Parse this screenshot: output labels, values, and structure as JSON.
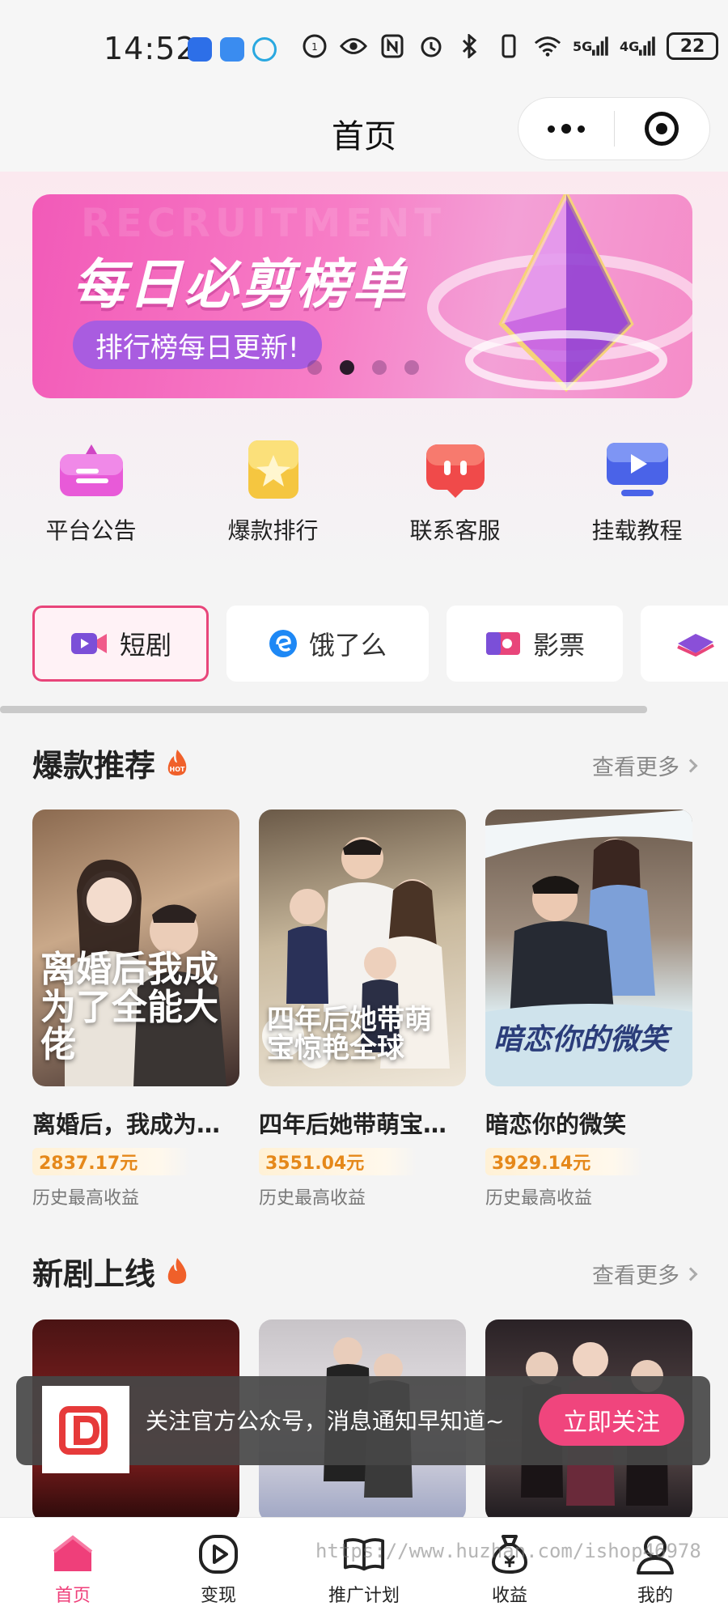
{
  "status_bar": {
    "time": "14:52",
    "net1": "5G",
    "net2": "4G",
    "battery": "22"
  },
  "nav": {
    "title": "首页"
  },
  "banner": {
    "title": "每日必剪榜单",
    "subtitle": "排行榜每日更新!",
    "ghost_text": "RECRUITMENT",
    "active_dot": 1
  },
  "quick_menu": [
    {
      "label": "平台公告",
      "icon": "announcement-icon"
    },
    {
      "label": "爆款排行",
      "icon": "ranking-star-icon"
    },
    {
      "label": "联系客服",
      "icon": "customer-service-icon"
    },
    {
      "label": "挂载教程",
      "icon": "tutorial-video-icon"
    }
  ],
  "categories": [
    {
      "label": "短剧",
      "active": true
    },
    {
      "label": "饿了么",
      "active": false
    },
    {
      "label": "影票",
      "active": false
    },
    {
      "label": "",
      "active": false
    }
  ],
  "hot_section": {
    "title": "爆款推荐",
    "more": "查看更多",
    "hot_badge": "HOT",
    "cards": [
      {
        "title": "离婚后，我成为…",
        "caption": "离婚后我成为了全能大佬",
        "earnings": "2837.17元",
        "earnings_label": "历史最高收益"
      },
      {
        "title": "四年后她带萌宝…",
        "caption": "四年后她带萌宝惊艳全球",
        "earnings": "3551.04元",
        "earnings_label": "历史最高收益"
      },
      {
        "title": "暗恋你的微笑",
        "caption": "暗恋你的微笑",
        "earnings": "3929.14元",
        "earnings_label": "历史最高收益"
      }
    ]
  },
  "new_section": {
    "title": "新剧上线",
    "more": "查看更多"
  },
  "toast": {
    "text": "关注官方公众号，消息通知早知道~",
    "button": "立即关注"
  },
  "tabs": [
    {
      "label": "首页",
      "icon": "home-icon",
      "active": true
    },
    {
      "label": "变现",
      "icon": "play-circle-icon",
      "active": false
    },
    {
      "label": "推广计划",
      "icon": "book-icon",
      "active": false
    },
    {
      "label": "收益",
      "icon": "money-bag-icon",
      "active": false
    },
    {
      "label": "我的",
      "icon": "user-icon",
      "active": false
    }
  ],
  "watermark": "https://www.huzhan.com/ishop46978",
  "colors": {
    "accent": "#ef3f7a",
    "earnings": "#e5881a",
    "banner": "#f25ab8"
  }
}
